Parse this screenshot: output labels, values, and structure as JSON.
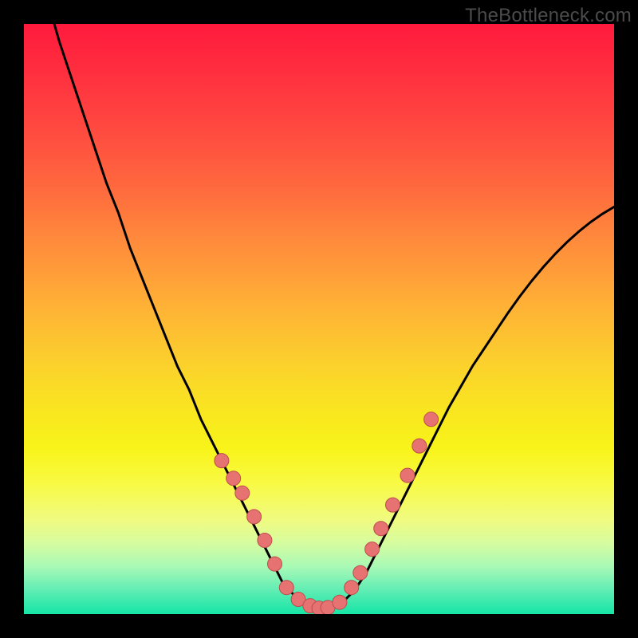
{
  "watermark": "TheBottleneck.com",
  "colors": {
    "curve": "#000000",
    "marker_fill": "#e77272",
    "marker_stroke": "#bd4d4d"
  },
  "chart_data": {
    "type": "line",
    "title": "",
    "xlabel": "",
    "ylabel": "",
    "xlim": [
      0,
      100
    ],
    "ylim": [
      0,
      100
    ],
    "grid": false,
    "series": [
      {
        "name": "bottleneck-curve",
        "x": [
          0,
          2,
          4,
          6,
          8,
          10,
          12,
          14,
          16,
          18,
          20,
          22,
          24,
          26,
          28,
          30,
          32,
          34,
          36,
          38,
          40,
          42,
          44,
          46,
          48,
          50,
          52,
          54,
          56,
          58,
          60,
          62,
          64,
          66,
          68,
          70,
          72,
          74,
          76,
          78,
          80,
          82,
          84,
          86,
          88,
          90,
          92,
          94,
          96,
          98,
          100
        ],
        "y": [
          118,
          111,
          104,
          97,
          91,
          85,
          79,
          73,
          68,
          62,
          57,
          52,
          47,
          42,
          38,
          33,
          29,
          25,
          21,
          17,
          13,
          9,
          5,
          3,
          1.5,
          1,
          1.2,
          2,
          4,
          7,
          11,
          15,
          19,
          23,
          27,
          31,
          35,
          38.5,
          42,
          45,
          48,
          51,
          53.8,
          56.4,
          58.8,
          61,
          63,
          64.8,
          66.4,
          67.8,
          69
        ]
      }
    ],
    "markers": {
      "name": "highlight-dots",
      "x": [
        33.5,
        35.5,
        37,
        39,
        40.8,
        42.5,
        44.5,
        46.5,
        48.5,
        50,
        51.5,
        53.5,
        55.5,
        57,
        59,
        60.5,
        62.5,
        65,
        67,
        69
      ],
      "y": [
        26,
        23,
        20.5,
        16.5,
        12.5,
        8.5,
        4.5,
        2.5,
        1.4,
        1,
        1.1,
        2,
        4.5,
        7,
        11,
        14.5,
        18.5,
        23.5,
        28.5,
        33
      ]
    }
  }
}
